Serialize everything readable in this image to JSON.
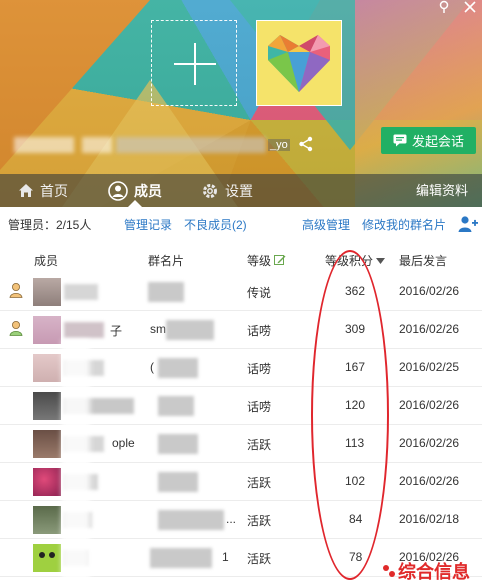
{
  "window": {
    "pin_icon": "pin-icon",
    "close_icon": "close-icon"
  },
  "header": {
    "group_id_fragment": "_yo",
    "start_chat_label": "发起会话",
    "colors": {
      "start_chat": "#21b064",
      "link": "#2b78c5",
      "annotation": "#e0262d"
    }
  },
  "tabs": [
    {
      "label": "首页",
      "icon": "home-icon"
    },
    {
      "label": "成员",
      "icon": "person-icon"
    },
    {
      "label": "设置",
      "icon": "gear-icon"
    }
  ],
  "edit_profile_label": "编辑资料",
  "admin_bar": {
    "admin_label": "管理员：2/15人",
    "manage_log": "管理记录",
    "bad_members": "不良成员(2)",
    "advanced": "高级管理",
    "edit_card": "修改我的群名片"
  },
  "table": {
    "headers": {
      "member": "成员",
      "card": "群名片",
      "level": "等级",
      "points": "等级积分",
      "last": "最后发言"
    },
    "rows": [
      {
        "nick_suffix": "",
        "card_text": "",
        "level": "传说",
        "points": "362",
        "last": "2016/02/26"
      },
      {
        "nick_suffix": "子",
        "card_text": "sm",
        "level": "话唠",
        "points": "309",
        "last": "2016/02/26"
      },
      {
        "nick_suffix": "",
        "card_text": "(",
        "level": "话唠",
        "points": "167",
        "last": "2016/02/25"
      },
      {
        "nick_suffix": "",
        "card_text": "",
        "level": "话唠",
        "points": "120",
        "last": "2016/02/26"
      },
      {
        "nick_suffix": "ople",
        "card_text": "",
        "level": "活跃",
        "points": "113",
        "last": "2016/02/26"
      },
      {
        "nick_suffix": "",
        "card_text": "",
        "level": "活跃",
        "points": "102",
        "last": "2016/02/26"
      },
      {
        "nick_suffix": "",
        "card_text": "...",
        "level": "活跃",
        "points": "84",
        "last": "2016/02/18"
      },
      {
        "nick_suffix": "",
        "card_text": "1",
        "level": "活跃",
        "points": "78",
        "last": "2016/02/26"
      }
    ]
  },
  "watermark": "综合信息"
}
